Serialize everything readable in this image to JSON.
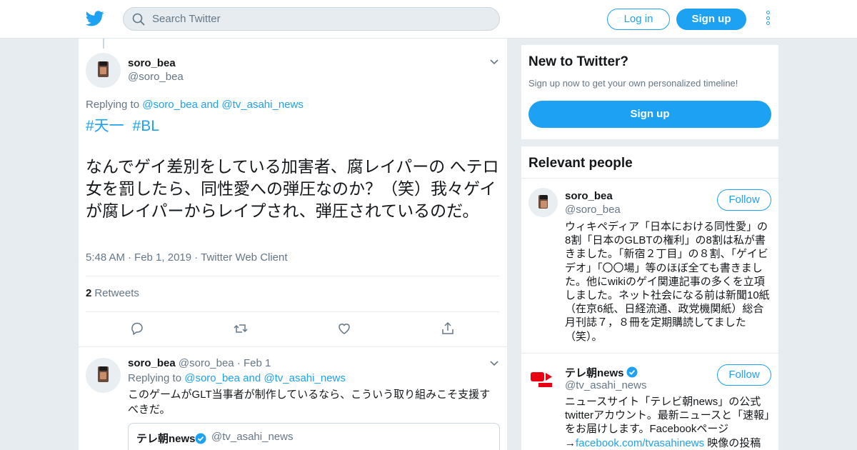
{
  "header": {
    "search_placeholder": "Search Twitter",
    "login_label": "Log in",
    "signup_label": "Sign up"
  },
  "main_tweet": {
    "name": "soro_bea",
    "handle": "@soro_bea",
    "replying_prefix": "Replying to",
    "replying_user1": "@soro_bea",
    "replying_and": "and",
    "replying_user2": "@tv_asahi_news",
    "hashtags": [
      "#天一",
      "#BL"
    ],
    "text": "なんでゲイ差別をしている加害者、腐レイパーの へテロ女を罰したら、同性愛への弾圧なのか？（笑）我々ゲイが腐レイパーからレイプされ、弾圧されているのだ。",
    "time": "5:48 AM",
    "date": "Feb 1, 2019",
    "client": "Twitter Web Client",
    "retweet_count": "2",
    "retweet_label": "Retweets"
  },
  "reply_tweet": {
    "name": "soro_bea",
    "handle": "@soro_bea",
    "date": "Feb 1",
    "replying_prefix": "Replying to",
    "replying_user1": "@soro_bea",
    "replying_and": "and",
    "replying_user2": "@tv_asahi_news",
    "text": "このゲームがGLT当事者が制作しているなら、こういう取り組みこそ支援すべきだ。",
    "quote_name": "テレ朝news",
    "quote_handle": "@tv_asahi_news"
  },
  "sidebar": {
    "new_title": "New to Twitter?",
    "new_sub": "Sign up now to get your own personalized timeline!",
    "new_button": "Sign up",
    "relevant_title": "Relevant people",
    "people": [
      {
        "name": "soro_bea",
        "handle": "@soro_bea",
        "follow_label": "Follow",
        "bio": "ウィキペディア「日本における同性愛」の8割「日本のGLBTの権利」の8割は私が書きました。「新宿２丁目」の８割、「ゲイビデオ」「〇〇場」等のほぼ全ても書きました。他にwikiのゲイ関連記事の多くを立項しました。ネット社会になる前は新聞10紙（在京6紙、日経流通、政党機関紙）総合月刊誌７，８冊を定期購読してました（笑）。"
      },
      {
        "name": "テレ朝news",
        "handle": "@tv_asahi_news",
        "follow_label": "Follow",
        "bio_text": "ニュースサイト「テレビ朝news」の公式twitterアカウント。最新ニュースと「速報」をお届けします。Facebookページ→",
        "bio_link": "facebook.com/tvasahinews",
        "bio_tail": " 映像の投稿"
      }
    ]
  },
  "colors": {
    "accent": "#1da1f2",
    "muted": "#657786",
    "background": "#e6ecf0"
  },
  "icons": [
    "twitter-bird-icon",
    "search-icon",
    "more-icon",
    "chevron-down-icon",
    "reply-icon",
    "retweet-icon",
    "like-icon",
    "share-icon",
    "verified-icon"
  ]
}
